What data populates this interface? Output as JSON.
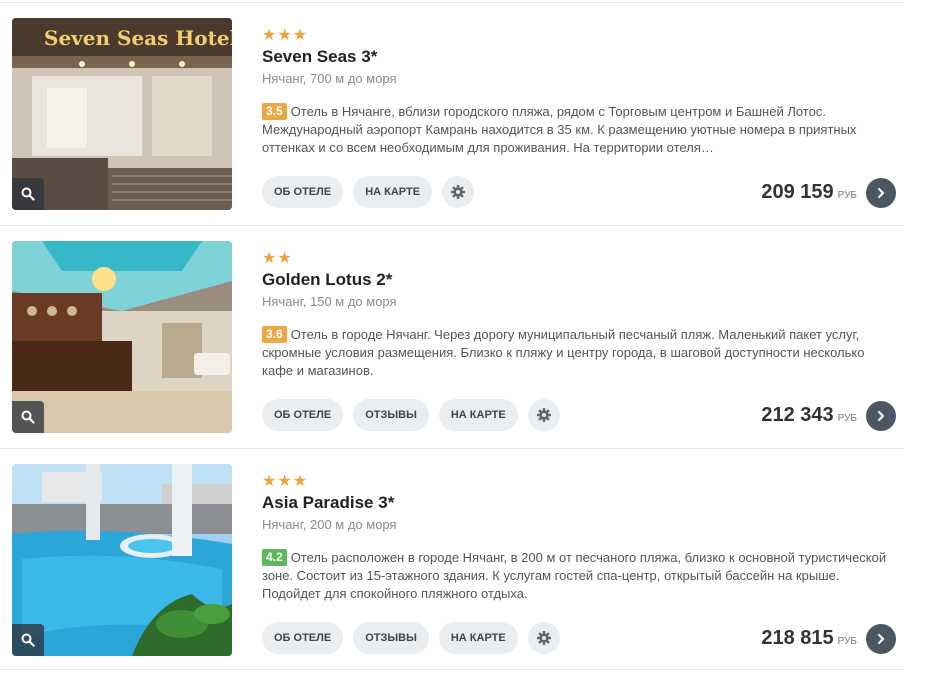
{
  "currency": "РУБ",
  "buttons": {
    "about": "ОБ ОТЕЛЕ",
    "reviews": "ОТЗЫВЫ",
    "map": "НА КАРТЕ"
  },
  "hotels": [
    {
      "stars": "★★★",
      "star_count": 3,
      "name": "Seven Seas 3*",
      "location": "Нячанг, 700 м до моря",
      "rating": "3.5",
      "rating_color": "#eda742",
      "description": "Отель в Нячанге, вблизи городского пляжа, рядом с Торговым центром и Башней Лотос. Международный аэропорт Камрань находится в 35 км. К размещению уютные номера в приятных оттенках и со всем необходимым для проживания. На территории отеля…",
      "price": "209 159",
      "photo_sign": "Seven Seas Hotel"
    },
    {
      "stars": "★★",
      "star_count": 2,
      "name": "Golden Lotus 2*",
      "location": "Нячанг, 150 м до моря",
      "rating": "3.6",
      "rating_color": "#eda742",
      "description": "Отель в городе Нячанг. Через дорогу муниципальный песчаный пляж. Маленький пакет услуг, скромные условия размещения. Близко к пляжу и центру города, в шаговой доступности несколько кафе и магазинов.",
      "price": "212 343"
    },
    {
      "stars": "★★★",
      "star_count": 3,
      "name": "Asia Paradise 3*",
      "location": "Нячанг, 200 м до моря",
      "rating": "4.2",
      "rating_color": "#5cb85c",
      "description": "Отель расположен в городе Нячанг, в 200 м от песчаного пляжа, близко к основной туристической зоне. Состоит из 15-этажного здания. К услугам гостей спа-центр, открытый бассейн на крыше. Подойдет для спокойного пляжного отдыха.",
      "price": "218 815"
    }
  ]
}
